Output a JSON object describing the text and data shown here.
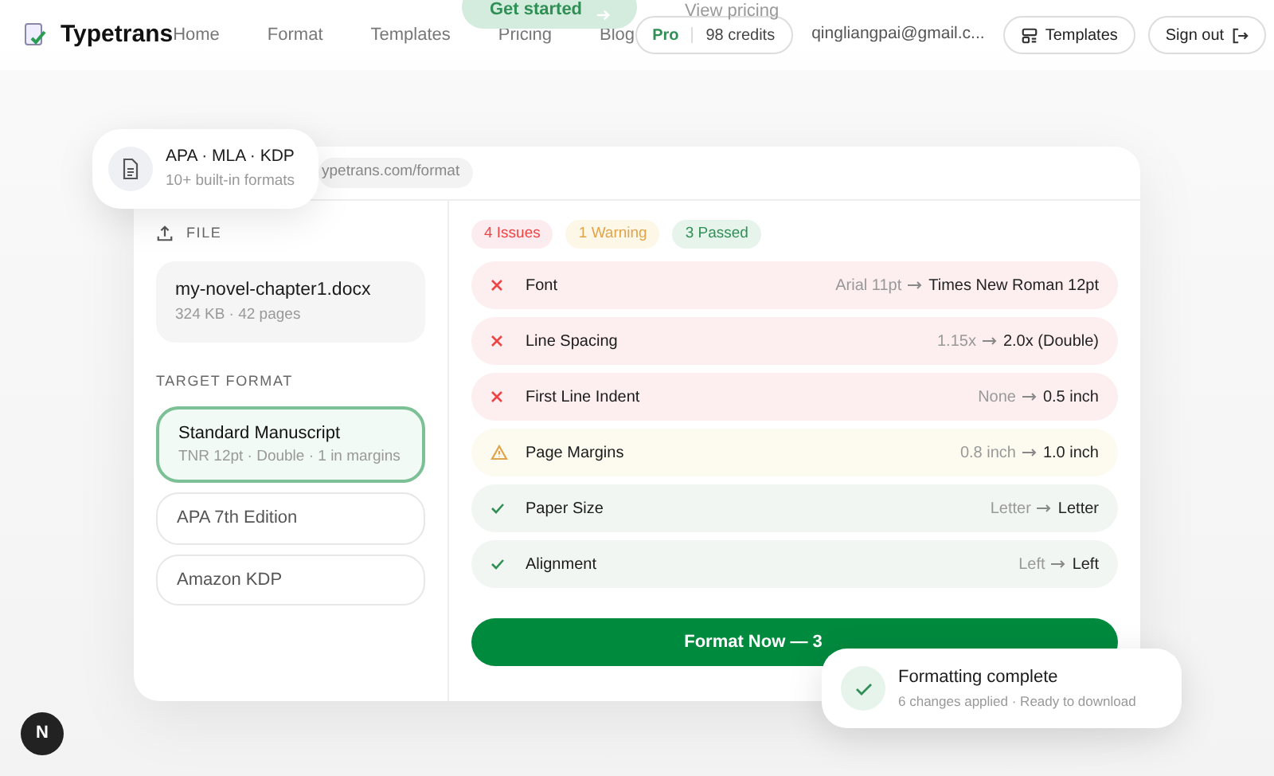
{
  "nav": {
    "brand": "Typetrans",
    "links": [
      "Home",
      "Format",
      "Templates",
      "Pricing",
      "Blog"
    ],
    "plan": "Pro",
    "credits": "98 credits",
    "email": "qingliangpai@gmail.c...",
    "buttons": [
      {
        "label": "Templates",
        "kind": "templates"
      },
      {
        "label": "Sign out",
        "kind": "signout"
      }
    ]
  },
  "hero": {
    "primary": "Get started",
    "secondary": "View pricing"
  },
  "floating_badge": {
    "title": "APA · MLA · KDP",
    "subtitle": "10+ built-in formats"
  },
  "address": "ypetrans.com/format",
  "file": {
    "label": "FILE",
    "name": "my-novel-chapter1.docx",
    "meta": "324 KB · 42 pages"
  },
  "target_format": {
    "label": "TARGET FORMAT",
    "options": [
      {
        "name": "Standard Manuscript",
        "detail": "TNR 12pt · Double · 1 in margins",
        "selected": true
      },
      {
        "name": "APA 7th Edition",
        "selected": false
      },
      {
        "name": "Amazon KDP",
        "selected": false
      }
    ]
  },
  "summary": [
    {
      "label": "4 Issues",
      "kind": "error"
    },
    {
      "label": "1 Warning",
      "kind": "warning"
    },
    {
      "label": "3 Passed",
      "kind": "passed"
    }
  ],
  "checks": [
    {
      "name": "Font",
      "from": "Arial 11pt",
      "to": "Times New Roman 12pt",
      "kind": "error"
    },
    {
      "name": "Line Spacing",
      "from": "1.15x",
      "to": "2.0x (Double)",
      "kind": "error"
    },
    {
      "name": "First Line Indent",
      "from": "None",
      "to": "0.5 inch",
      "kind": "error"
    },
    {
      "name": "Page Margins",
      "from": "0.8 inch",
      "to": "1.0 inch",
      "kind": "warning"
    },
    {
      "name": "Paper Size",
      "from": "Letter",
      "to": "Letter",
      "kind": "passed"
    },
    {
      "name": "Alignment",
      "from": "Left",
      "to": "Left",
      "kind": "passed"
    }
  ],
  "action": "Format Now — 3",
  "toast": {
    "title": "Formatting complete",
    "message": "6 changes applied · Ready to download"
  },
  "dev_indicator": "N"
}
